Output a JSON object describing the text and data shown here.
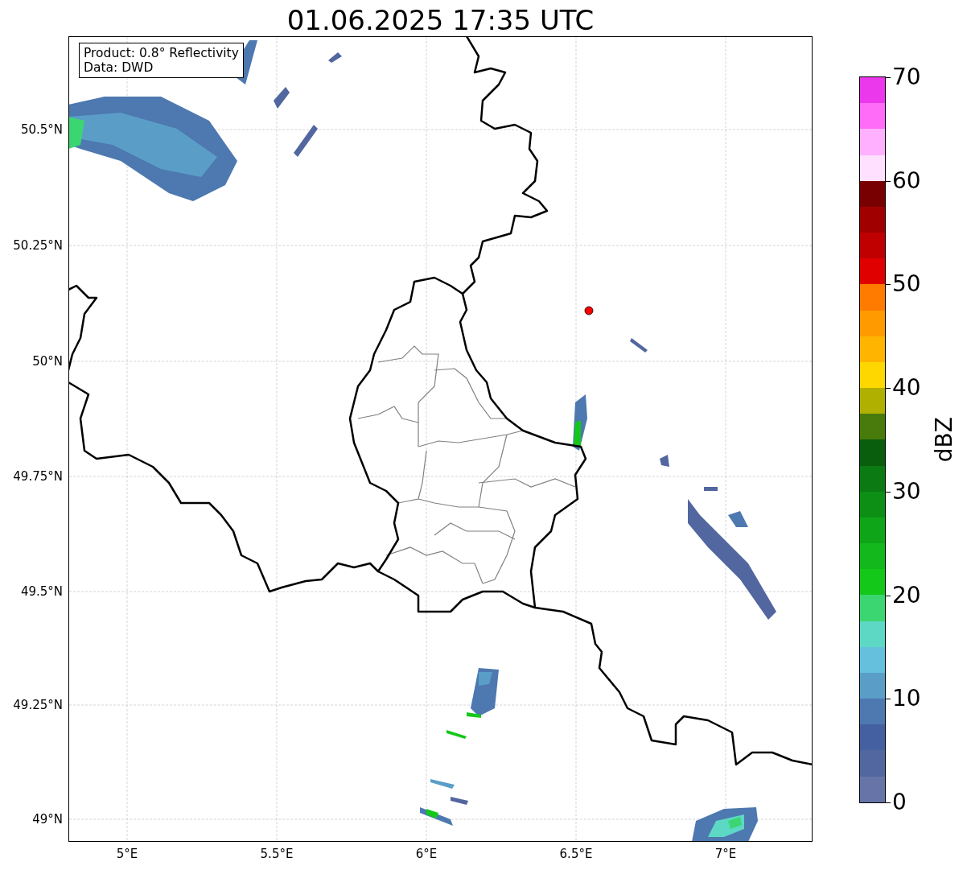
{
  "title": "01.06.2025 17:35 UTC",
  "info_box": {
    "lines": [
      "Product: 0.8° Reflectivity",
      "Data: DWD"
    ]
  },
  "map": {
    "kind": "map",
    "y_ticks": [
      "50.5°N",
      "50.25°N",
      "50°N",
      "49.75°N",
      "49.5°N",
      "49.25°N",
      "49°N"
    ],
    "x_ticks": [
      "5°E",
      "5.5°E",
      "6°E",
      "6.5°E",
      "7°E"
    ]
  },
  "colorbar": {
    "label": "dBZ",
    "ticks": [
      "70",
      "60",
      "50",
      "40",
      "30",
      "20",
      "10",
      "0"
    ],
    "bins": [
      {
        "color": "#ec38ec"
      },
      {
        "color": "#ff6cf8"
      },
      {
        "color": "#ffb0ff"
      },
      {
        "color": "#ffe0ff"
      },
      {
        "color": "#780000"
      },
      {
        "color": "#a00000"
      },
      {
        "color": "#c00000"
      },
      {
        "color": "#e00000"
      },
      {
        "color": "#ff7b00"
      },
      {
        "color": "#ff9a00"
      },
      {
        "color": "#ffb400"
      },
      {
        "color": "#ffd700"
      },
      {
        "color": "#b0b000"
      },
      {
        "color": "#487a0c"
      },
      {
        "color": "#085e0c"
      },
      {
        "color": "#0b7a12"
      },
      {
        "color": "#0d8f16"
      },
      {
        "color": "#0fa518"
      },
      {
        "color": "#12b81c"
      },
      {
        "color": "#14c81a"
      },
      {
        "color": "#3bd671"
      },
      {
        "color": "#5dd8c4"
      },
      {
        "color": "#64c0dc"
      },
      {
        "color": "#5a9ec8"
      },
      {
        "color": "#4d78b0"
      },
      {
        "color": "#4460a0"
      },
      {
        "color": "#52669f"
      },
      {
        "color": "#6674a8"
      }
    ]
  }
}
